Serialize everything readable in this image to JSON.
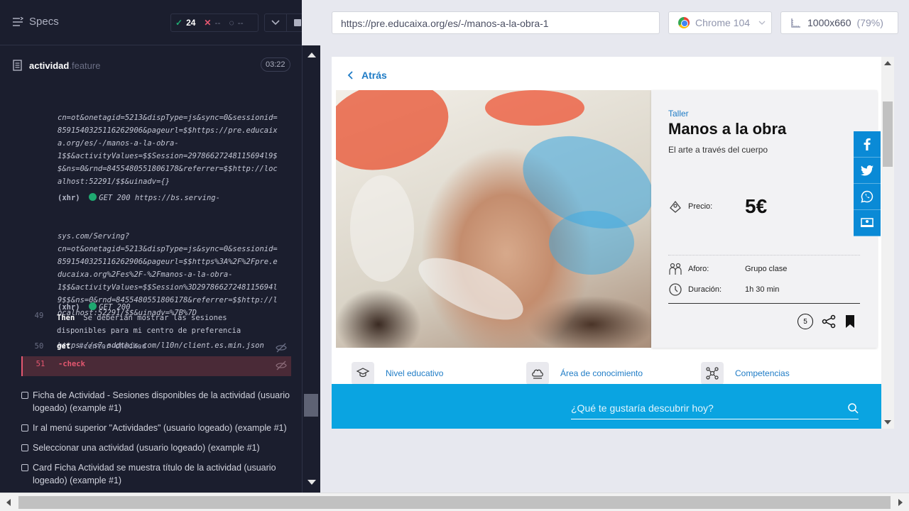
{
  "reporter": {
    "specs_label": "Specs",
    "stats": {
      "passed": "24",
      "failed": "--",
      "pending": "--"
    },
    "file": {
      "name": "actividad",
      "ext": ".feature",
      "duration": "03:22"
    },
    "log_blocks": [
      {
        "head": "",
        "body": "cn=ot&onetagid=5213&dispType=js&sync=0&sessionid=\n8591540325116262906&pageurl=$$https://pre.educaix\na.org/es/-/manos-a-la-obra-\n1$$&activityValues=$$Session=29786627248115694l9$\n$&ns=0&rnd=8455480551806178&referrer=$$http://loc\nalhost:52291/$$&uinadv={}"
      },
      {
        "head": "GET 200 https://bs.serving-",
        "body": "sys.com/Serving?\ncn=ot&onetagid=5213&dispType=js&sync=0&sessionid=\n8591540325116262906&pageurl=$$https%3A%2F%2Fpre.e\nducaixa.org%2Fes%2F-%2Fmanos-a-la-obra-\n1$$&activityValues=$$Session%3D29786627248115694l\n9$$&ns=0&rnd=8455480551806178&referrer=$$http://l\nocalhost:52291/$$&uinadv=%7B%7D"
      },
      {
        "head": "GET 200",
        "body": "https://s7.addthis.com/l10n/client.es.min.json"
      }
    ],
    "xhr_tag": "(xhr)",
    "steps": [
      {
        "line": "49",
        "keyword": "Then",
        "text": "Se deberian mostrar las sesiones\ndisponibles para mi centro de preferencia"
      },
      {
        "line": "50",
        "keyword": "get",
        "text": "#center-checked"
      },
      {
        "line": "51",
        "keyword": "-check",
        "text": ""
      }
    ],
    "tests": [
      "Ficha de Actividad - Sesiones disponibles de la actividad (usuario logeado) (example #1)",
      "Ir al menú superior \"Actividades\" (usuario logeado) (example #1)",
      "Seleccionar una actividad (usuario logeado) (example #1)",
      "Card Ficha Actividad se muestra título de la actividad (usuario logeado) (example #1)"
    ]
  },
  "browser": {
    "url": "https://pre.educaixa.org/es/-/manos-a-la-obra-1",
    "browser_name": "Chrome 104",
    "viewport": "1000x660",
    "zoom": "(79%)"
  },
  "page": {
    "back_label": "Atrás",
    "category": "Taller",
    "title": "Manos a la obra",
    "subtitle": "El arte a través del cuerpo",
    "price_label": "Precio:",
    "price_value": "5€",
    "aforo_label": "Aforo:",
    "aforo_value": "Grupo clase",
    "duracion_label": "Duración:",
    "duracion_value": "1h 30 min",
    "sessions_count": "5",
    "areas": [
      "Nivel educativo",
      "Área de conocimiento",
      "Competencias"
    ],
    "search_placeholder": "¿Qué te gustaría descubrir hoy?",
    "share_icons": [
      "facebook-icon",
      "twitter-icon",
      "whatsapp-icon",
      "classroom-icon"
    ]
  },
  "colors": {
    "reporter_bg": "#1b1e2e",
    "pass": "#1fa971",
    "fail": "#e45770",
    "brand_blue": "#0aa4e1",
    "link_blue": "#1f7cc6"
  }
}
